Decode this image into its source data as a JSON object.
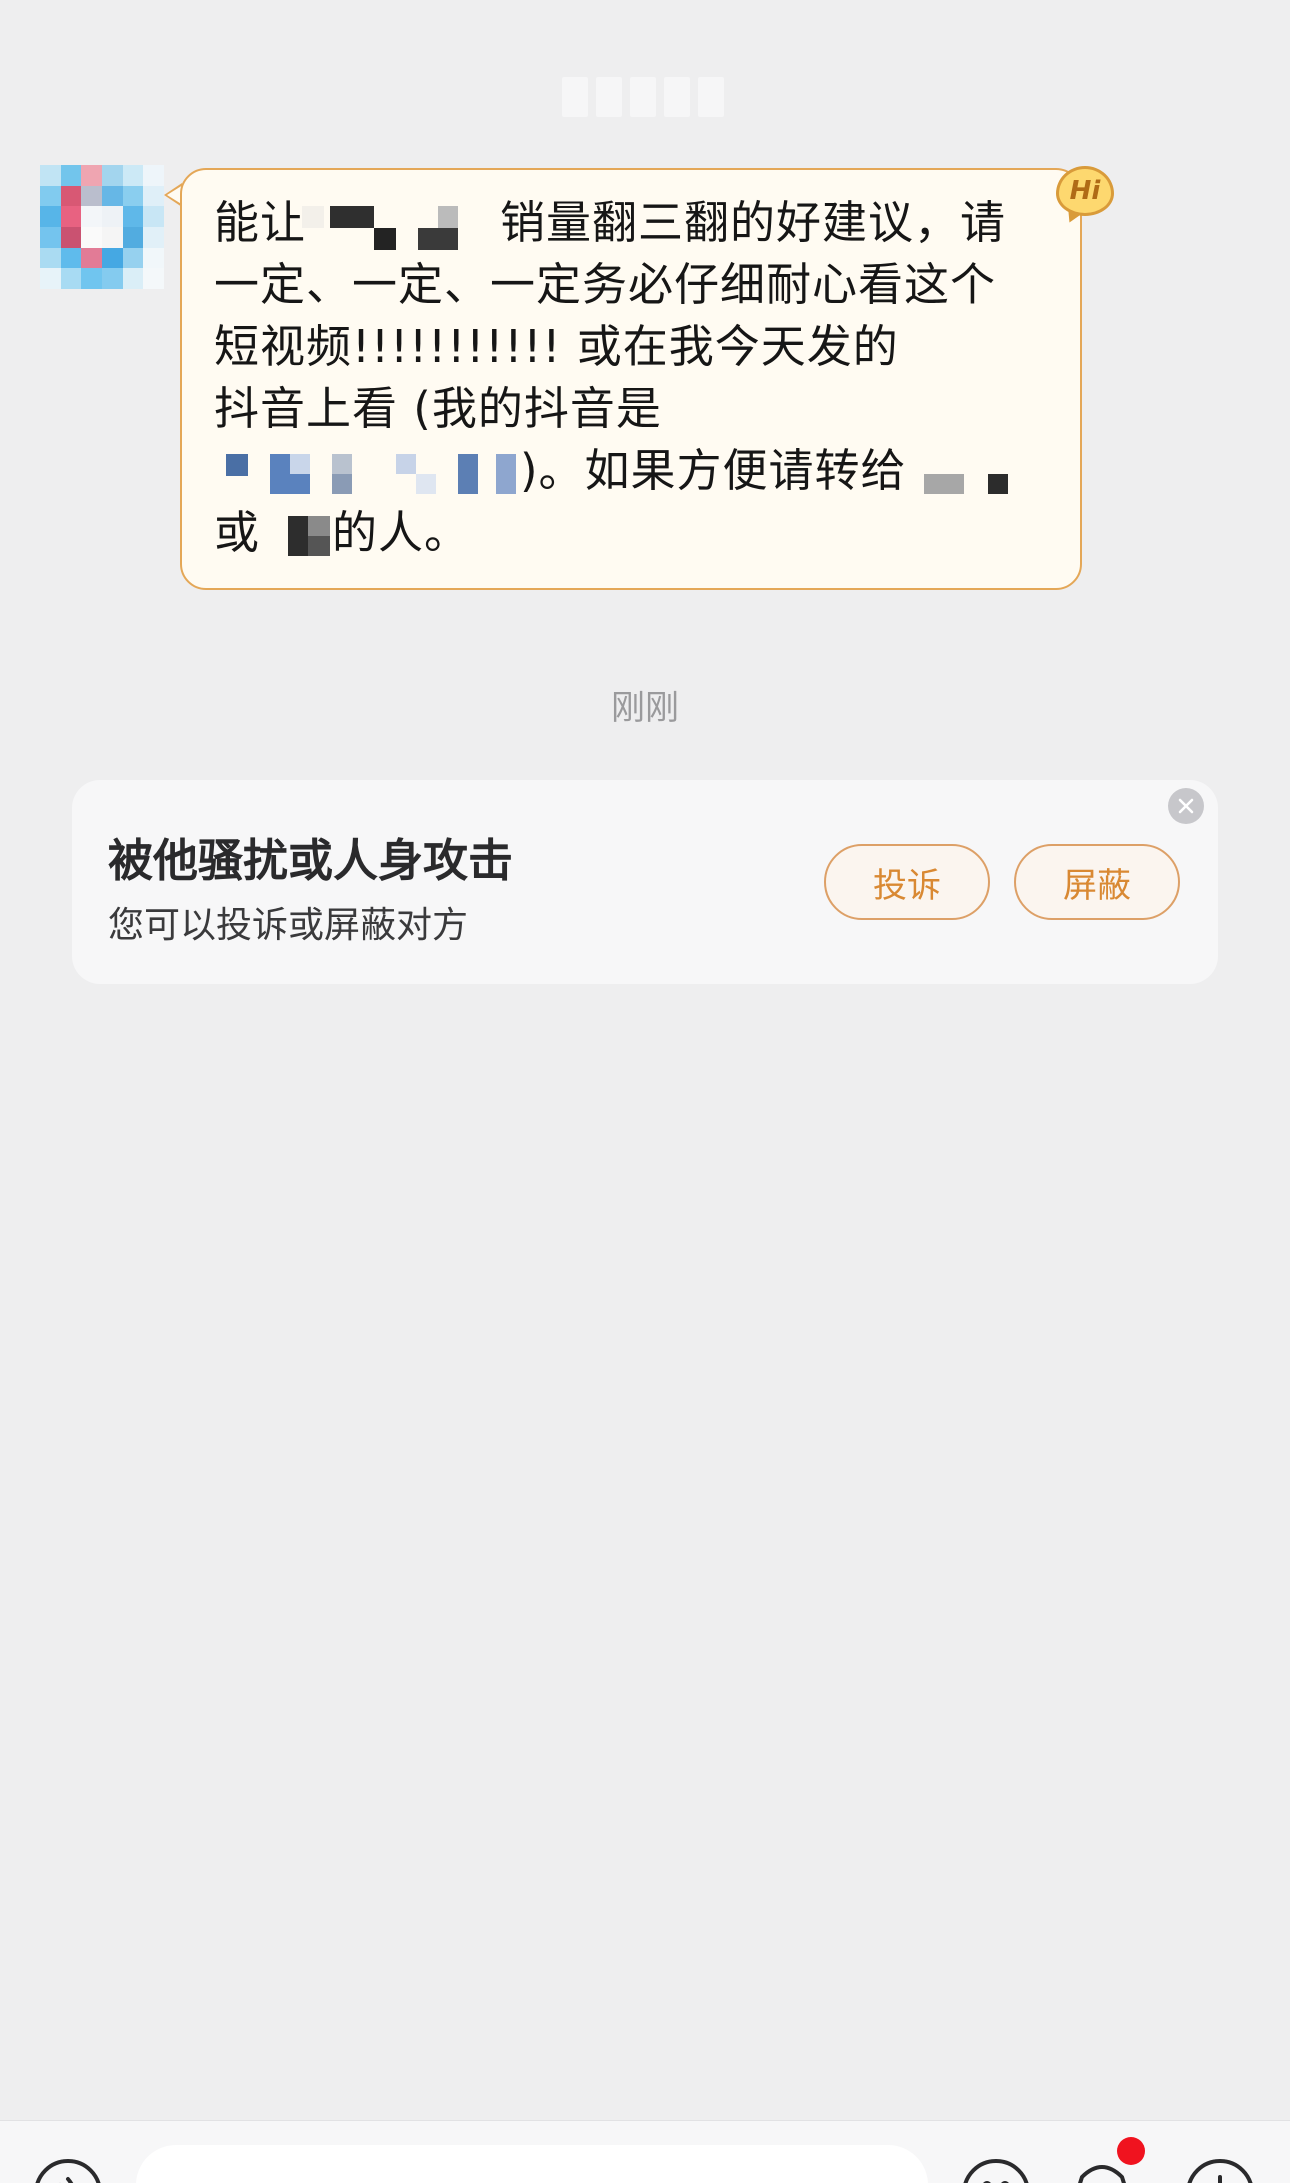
{
  "message": {
    "line1_a": "能让",
    "line1_b": "销量翻三翻的好建议，请",
    "line2": "一定、一定、一定务必仔细耐心看这个",
    "line3": "短视频!!!!!!!!!!! 或在我今天发的",
    "line4": "抖音上看 (我的抖音是",
    "line5": ")。如果方便请转给",
    "line6_a": "或",
    "line6_b": "的人。",
    "badge": "Hi"
  },
  "timestamp": "刚刚",
  "notice": {
    "title": "被他骚扰或人身攻击",
    "subtitle": "您可以投诉或屏蔽对方",
    "complain_label": "投诉",
    "block_label": "屏蔽"
  },
  "colors": {
    "accent": "#e4a757",
    "button_text": "#d98933",
    "notification_dot": "#f0131f",
    "background": "#eeeeef"
  },
  "icons": {
    "voice": "voice-icon",
    "emoji": "emoji-icon",
    "more": "plus-icon",
    "hi": "hi-badge-icon",
    "close": "close-icon"
  }
}
